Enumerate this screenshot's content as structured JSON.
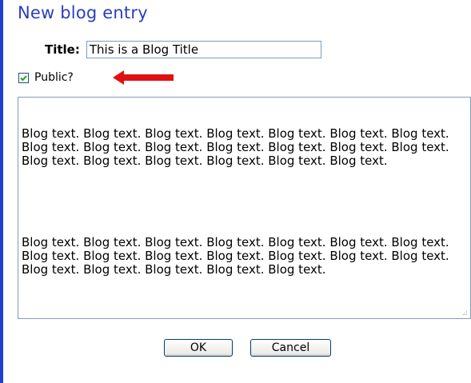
{
  "dialog": {
    "title": "New blog entry"
  },
  "title_field": {
    "label": "Title:",
    "value": "This is a Blog Title"
  },
  "public_checkbox": {
    "label": "Public?",
    "checked": true
  },
  "annotation": {
    "arrow_color": "#e01010",
    "icon": "red-arrow-left"
  },
  "body": {
    "paragraphs": [
      "Blog text. Blog text. Blog text. Blog text. Blog text. Blog text. Blog text. Blog text. Blog text. Blog text. Blog text. Blog text. Blog text. Blog text. Blog text. Blog text. Blog text. Blog text. Blog text. Blog text.",
      "Blog text. Blog text. Blog text. Blog text. Blog text. Blog text. Blog text. Blog text. Blog text. Blog text. Blog text. Blog text. Blog text. Blog text. Blog text. Blog text. Blog text. Blog text. Blog text."
    ]
  },
  "buttons": {
    "ok_label": "OK",
    "cancel_label": "Cancel"
  },
  "colors": {
    "accent": "#2a3fbf",
    "left_bar": "#1a3fd1",
    "input_border": "#7f9db9"
  }
}
